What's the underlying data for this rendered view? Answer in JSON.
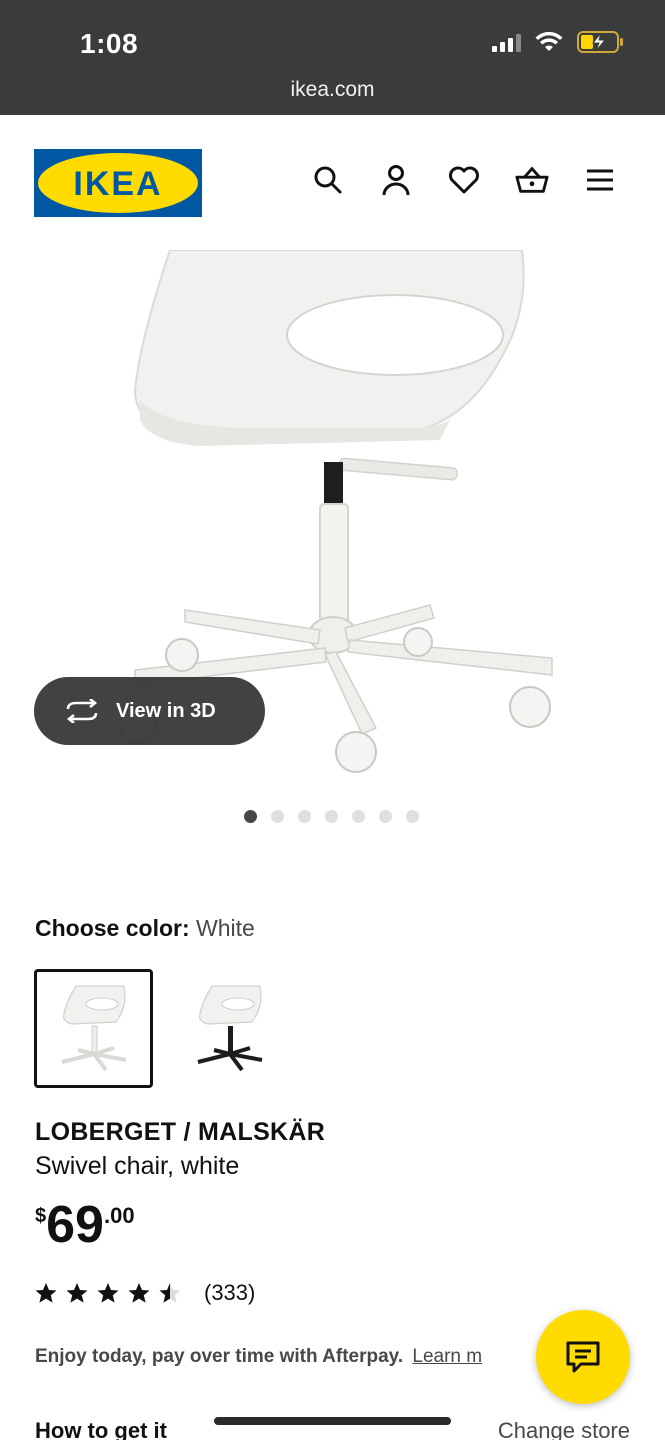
{
  "status_bar": {
    "time": "1:08"
  },
  "browser": {
    "url": "ikea.com"
  },
  "header": {
    "logo_text": "IKEA",
    "icons": [
      "search-icon",
      "account-icon",
      "heart-icon",
      "basket-icon",
      "menu-icon"
    ]
  },
  "gallery": {
    "view3d_label": "View in 3D",
    "image_count": 7,
    "active_index": 0
  },
  "color": {
    "label": "Choose color:",
    "selected": "White",
    "options": [
      "white",
      "white/black"
    ]
  },
  "product": {
    "name": "LOBERGET / MALSKÄR",
    "description": "Swivel chair, white",
    "price_currency": "$",
    "price_int": "69",
    "price_dec": ".00",
    "rating": 4.5,
    "rating_count": "(333)"
  },
  "afterpay": {
    "text": "Enjoy today, pay over time with Afterpay.",
    "link": "Learn m"
  },
  "delivery": {
    "heading": "How to get it",
    "change_store": "Change store"
  },
  "colors": {
    "ikea_blue": "#0058a3",
    "ikea_yellow": "#ffdb00",
    "browser_bar": "#3a3b3b"
  }
}
